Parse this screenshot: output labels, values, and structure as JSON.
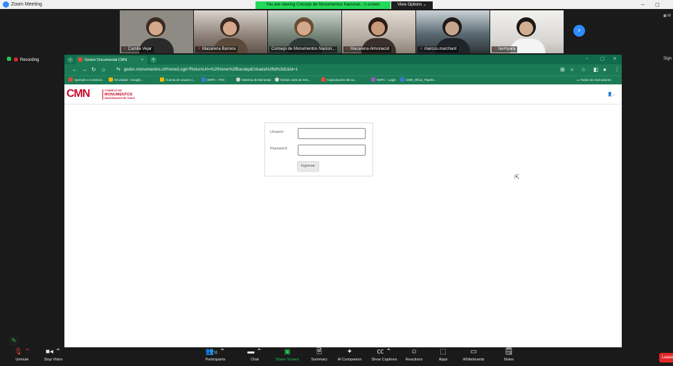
{
  "zoom": {
    "window_title": "Zoom Meeting",
    "share_banner": "You are viewing Consejo de Monumentos Nacional...'s screen",
    "view_options": "View Options",
    "recording_label": "Recording",
    "right_edge_text": "Sign",
    "right_edge_top": "W"
  },
  "participants": [
    {
      "name": "Camila Vejar",
      "bg": "#8e8a84"
    },
    {
      "name": "Macarena Barrera",
      "bg": "#6b5e55"
    },
    {
      "name": "Consejo de Monumentos Nacion...",
      "bg": "#7a8a7d"
    },
    {
      "name": "Macarena Almonacid",
      "bg": "#b7aea4"
    },
    {
      "name": "marcos.marchant",
      "bg": "#5a6a72"
    },
    {
      "name": "lavmyara",
      "bg": "#d8d6d2"
    }
  ],
  "browser": {
    "tab_title": "Gestor Documental CMN",
    "tab_close": "×",
    "new_tab": "+",
    "url": "gedoc.monumentos.cl/Home/Login?ReturnUrl=%2fHome%2fBandejaEntrada%3fId%3d1&id=1",
    "bookmarks": [
      {
        "label": "Aprende a Construir...",
        "color": "#e34b3c"
      },
      {
        "label": "Mi unidad - Google...",
        "color": "#f2b705"
      },
      {
        "label": "Cuenta de usuario (...",
        "color": "#f2b705"
      },
      {
        "label": "SNPC - TRX",
        "color": "#3a7bd5"
      },
      {
        "label": "Sistema de Bienestar",
        "color": "#cfd8dc"
      },
      {
        "label": "Módulo web de Ges...",
        "color": "#cfd8dc"
      },
      {
        "label": "Capacitación del nu...",
        "color": "#e34b3c"
      },
      {
        "label": "SNPC - Login",
        "color": "#9b59b6"
      },
      {
        "label": "CMN_Oficio_Papele...",
        "color": "#3a7bd5"
      }
    ],
    "all_bookmarks": "Todos los marcadores"
  },
  "page": {
    "logo_text": "CMN",
    "logo_sub_1": "CONSEJO DE",
    "logo_sub_2": "MONUMENTOS",
    "logo_sub_3": "NACIONALES DE CHILE",
    "login": {
      "user_label": "Usuario:",
      "password_label": "Password:",
      "user_value": "",
      "password_value": "",
      "submit_label": "Ingresar"
    }
  },
  "toolbar": {
    "unmute": "Unmute",
    "stop_video": "Stop Video",
    "participants": "Participants",
    "participants_count": "11",
    "chat": "Chat",
    "share_screen": "Share Screen",
    "summary": "Summary",
    "ai_companion": "AI Companion",
    "show_captions": "Show Captions",
    "reactions": "Reactions",
    "apps": "Apps",
    "whiteboards": "Whiteboards",
    "notes": "Notes",
    "leave": "Leave"
  },
  "colors": {
    "zoom_bg": "#1a1a1a",
    "share_green": "#23d959",
    "browser_green": "#1c7b57",
    "cmn_red": "#c8102e",
    "leave_red": "#e02828"
  }
}
